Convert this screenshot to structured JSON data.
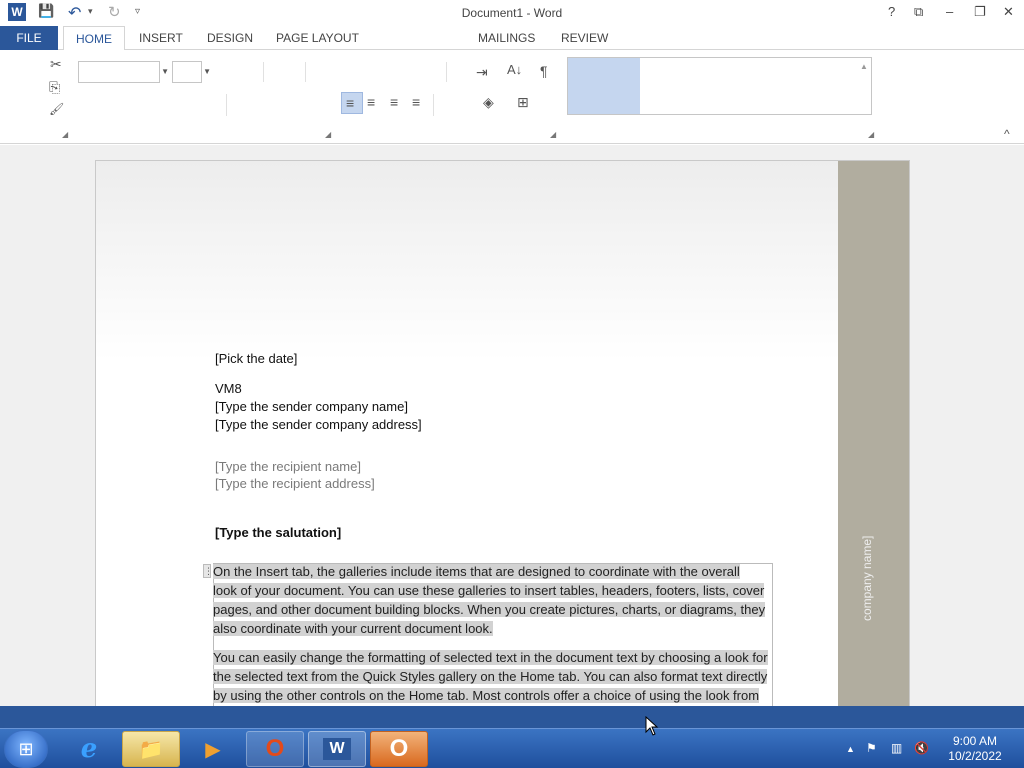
{
  "window": {
    "title": "Document1 - Word",
    "help_glyph": "?",
    "ribbon_display_glyph": "⧉",
    "minimize_glyph": "–",
    "restore_glyph": "❐",
    "close_glyph": "✕"
  },
  "quick_access": {
    "word_icon": "W",
    "save_glyph": "💾",
    "undo_glyph": "↶",
    "undo_dropdown": "▾",
    "redo_glyph": "↻",
    "customize_glyph": "▿"
  },
  "tabs": [
    "FILE",
    "HOME",
    "INSERT",
    "DESIGN",
    "PAGE LAYOUT",
    "MAILINGS",
    "REVIEW"
  ],
  "ribbon": {
    "cut_glyph": "✂",
    "copy_glyph": "⎘",
    "format_painter_glyph": "🖌",
    "font_name": "",
    "font_size": "",
    "indent_glyph": "⇥",
    "sort_glyph": "A↓",
    "pilcrow_glyph": "¶",
    "align_left_glyph": "≡",
    "align_center_glyph": "≡",
    "align_right_glyph": "≡",
    "justify_glyph": "≡",
    "shading_glyph": "◈",
    "borders_glyph": "⊞",
    "collapse_glyph": "^"
  },
  "document": {
    "date": "[Pick the date]",
    "sender_name": "VM8",
    "sender_company": "[Type the sender company name]",
    "sender_address": "[Type the sender company address]",
    "recipient_name": "[Type the recipient name]",
    "recipient_address": "[Type the recipient address]",
    "salutation": "[Type the salutation]",
    "para1_lines": [
      "On the Insert tab, the galleries include items that are designed to coordinate with the overall",
      "look of your document. You can use these galleries to insert tables, headers, footers, lists, cover",
      "pages, and other document building blocks. When you create pictures, charts, or diagrams, they",
      "also coordinate with your current document look."
    ],
    "para2_lines": [
      "You can easily change the formatting of selected text in the document text by choosing a look for",
      "the selected text from the Quick Styles gallery on the Home tab. You can also format text directly",
      "by using the other controls on the Home tab. Most controls offer a choice of using the look from"
    ],
    "sidebar_text": "company name]"
  },
  "taskbar": {
    "start_glyph": "⊞",
    "apps": [
      {
        "name": "internet-explorer",
        "glyph": "e"
      },
      {
        "name": "file-explorer",
        "glyph": "📁"
      },
      {
        "name": "media-player",
        "glyph": "▶"
      },
      {
        "name": "office",
        "glyph": "O"
      },
      {
        "name": "word",
        "glyph": "W"
      },
      {
        "name": "office-active",
        "glyph": "O"
      }
    ],
    "tray_up_glyph": "▲",
    "flag_glyph": "⚑",
    "network_glyph": "▥",
    "volume_glyph": "🔇",
    "time": "9:00 AM",
    "date": "10/2/2022"
  },
  "colors": {
    "accent": "#2b579a",
    "sidebar": "#b1ad9f",
    "highlight": "#d2d2d2"
  }
}
